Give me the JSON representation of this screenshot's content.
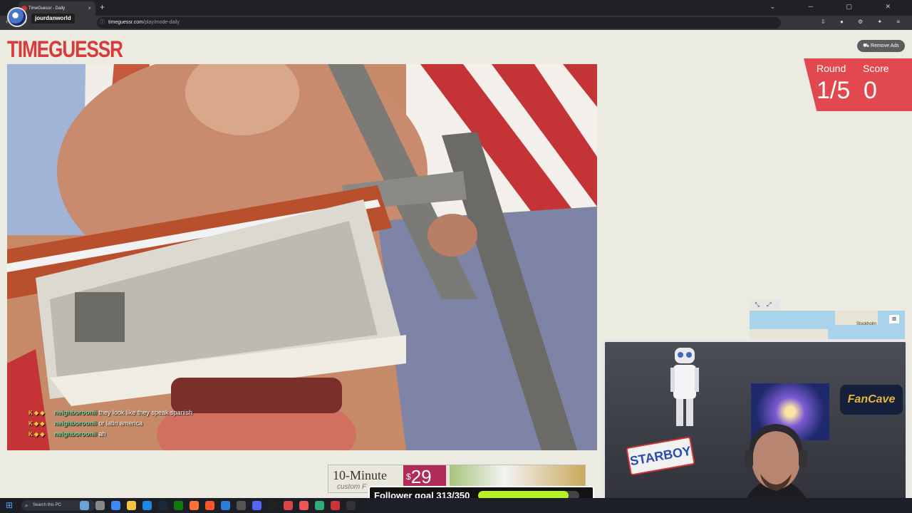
{
  "browser": {
    "tab_title": "TimeGuessr - Daily",
    "tab_close": "×",
    "new_tab": "+",
    "url_host": "timeguessr.com",
    "url_path": "/play/mode-daily",
    "nav_icons": "‹ › ⟳",
    "right_icons": "⇩ ● ⚙ ✦ ≡",
    "window_controls": "⌄ ─ ▢ ✕"
  },
  "overlay": {
    "streamer_name": "jourdanworld"
  },
  "game": {
    "logo": "TIMEGUESSR",
    "remove_ads": "Remove Ads",
    "round_label": "Round",
    "round_value": "1/5",
    "score_label": "Score",
    "score_value": "0"
  },
  "chat": [
    {
      "badges": "K ◆ ◆",
      "user": "neighboroonii",
      "message": " they look like they speak spanish"
    },
    {
      "badges": "K ◆ ◆",
      "user": "neighboroonii",
      "message": " or latin america"
    },
    {
      "badges": "K ◆ ◆",
      "user": "neighboroonii",
      "message": " ah"
    }
  ],
  "minimap": {
    "controls": "⤡ ⤢ ⇔",
    "city_label": "Stockholm",
    "layer_button": "▥"
  },
  "webcam": {
    "sign_starboy": "STARBOY",
    "sign_fancave": "FanCave"
  },
  "ad": {
    "headline": "10-Minute",
    "subline": "custom F",
    "price_currency": "$",
    "price_value": "29"
  },
  "follower_goal": {
    "label": "Follower goal 313/350",
    "current": 313,
    "target": 350
  },
  "taskbar": {
    "search_placeholder": "Search this PC",
    "icons": [
      "weather-icon",
      "task-view-icon",
      "chrome-icon",
      "file-explorer-icon",
      "edge-icon",
      "steam-icon",
      "xbox-icon",
      "firefox-icon",
      "brave-icon",
      "vscode-icon",
      "notepad-icon",
      "discord-icon",
      "terminal-icon",
      "tool-icon",
      "star-icon",
      "game-icon",
      "news-icon",
      "obs-icon"
    ],
    "colors": {
      "accent": "#e2494f",
      "logo": "#d93a3a",
      "goal_fill": "#b6f226"
    }
  }
}
